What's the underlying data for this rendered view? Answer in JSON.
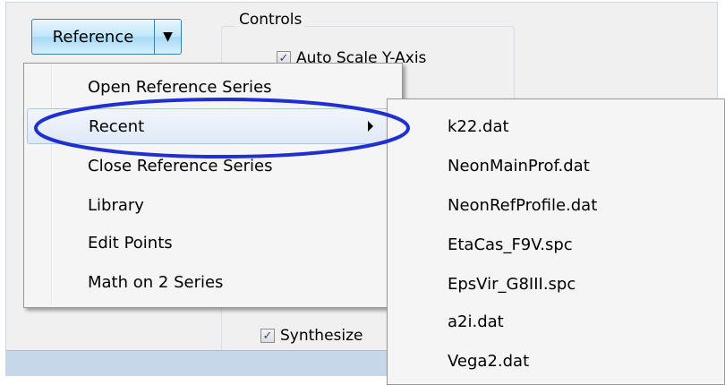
{
  "reference_button": {
    "label": "Reference",
    "arrow": "▼"
  },
  "controls": {
    "title": "Controls",
    "autoscale_label": "Auto Scale Y-Axis",
    "synthesize_label": "Synthesize",
    "synthesize_checked": true,
    "autoscale_checked": true
  },
  "reference_menu": {
    "items": [
      {
        "label": "Open Reference Series"
      },
      {
        "label": "Recent",
        "highlighted": true,
        "has_submenu": true
      },
      {
        "label": "Close Reference Series"
      },
      {
        "label": "Library"
      },
      {
        "label": "Edit Points"
      },
      {
        "label": "Math on 2 Series"
      }
    ]
  },
  "recent_submenu": {
    "items": [
      {
        "label": "k22.dat"
      },
      {
        "label": "NeonMainProf.dat"
      },
      {
        "label": "NeonRefProfile.dat"
      },
      {
        "label": "EtaCas_F9V.spc"
      },
      {
        "label": "EpsVir_G8III.spc"
      },
      {
        "label": "a2i.dat"
      },
      {
        "label": "Vega2.dat"
      }
    ]
  },
  "colors": {
    "annotation_ellipse": "#1f2fd0",
    "menu_highlight_border": "#a8c6e8",
    "button_border": "#3c7fb1",
    "statusbar": "#c7d7ea"
  }
}
